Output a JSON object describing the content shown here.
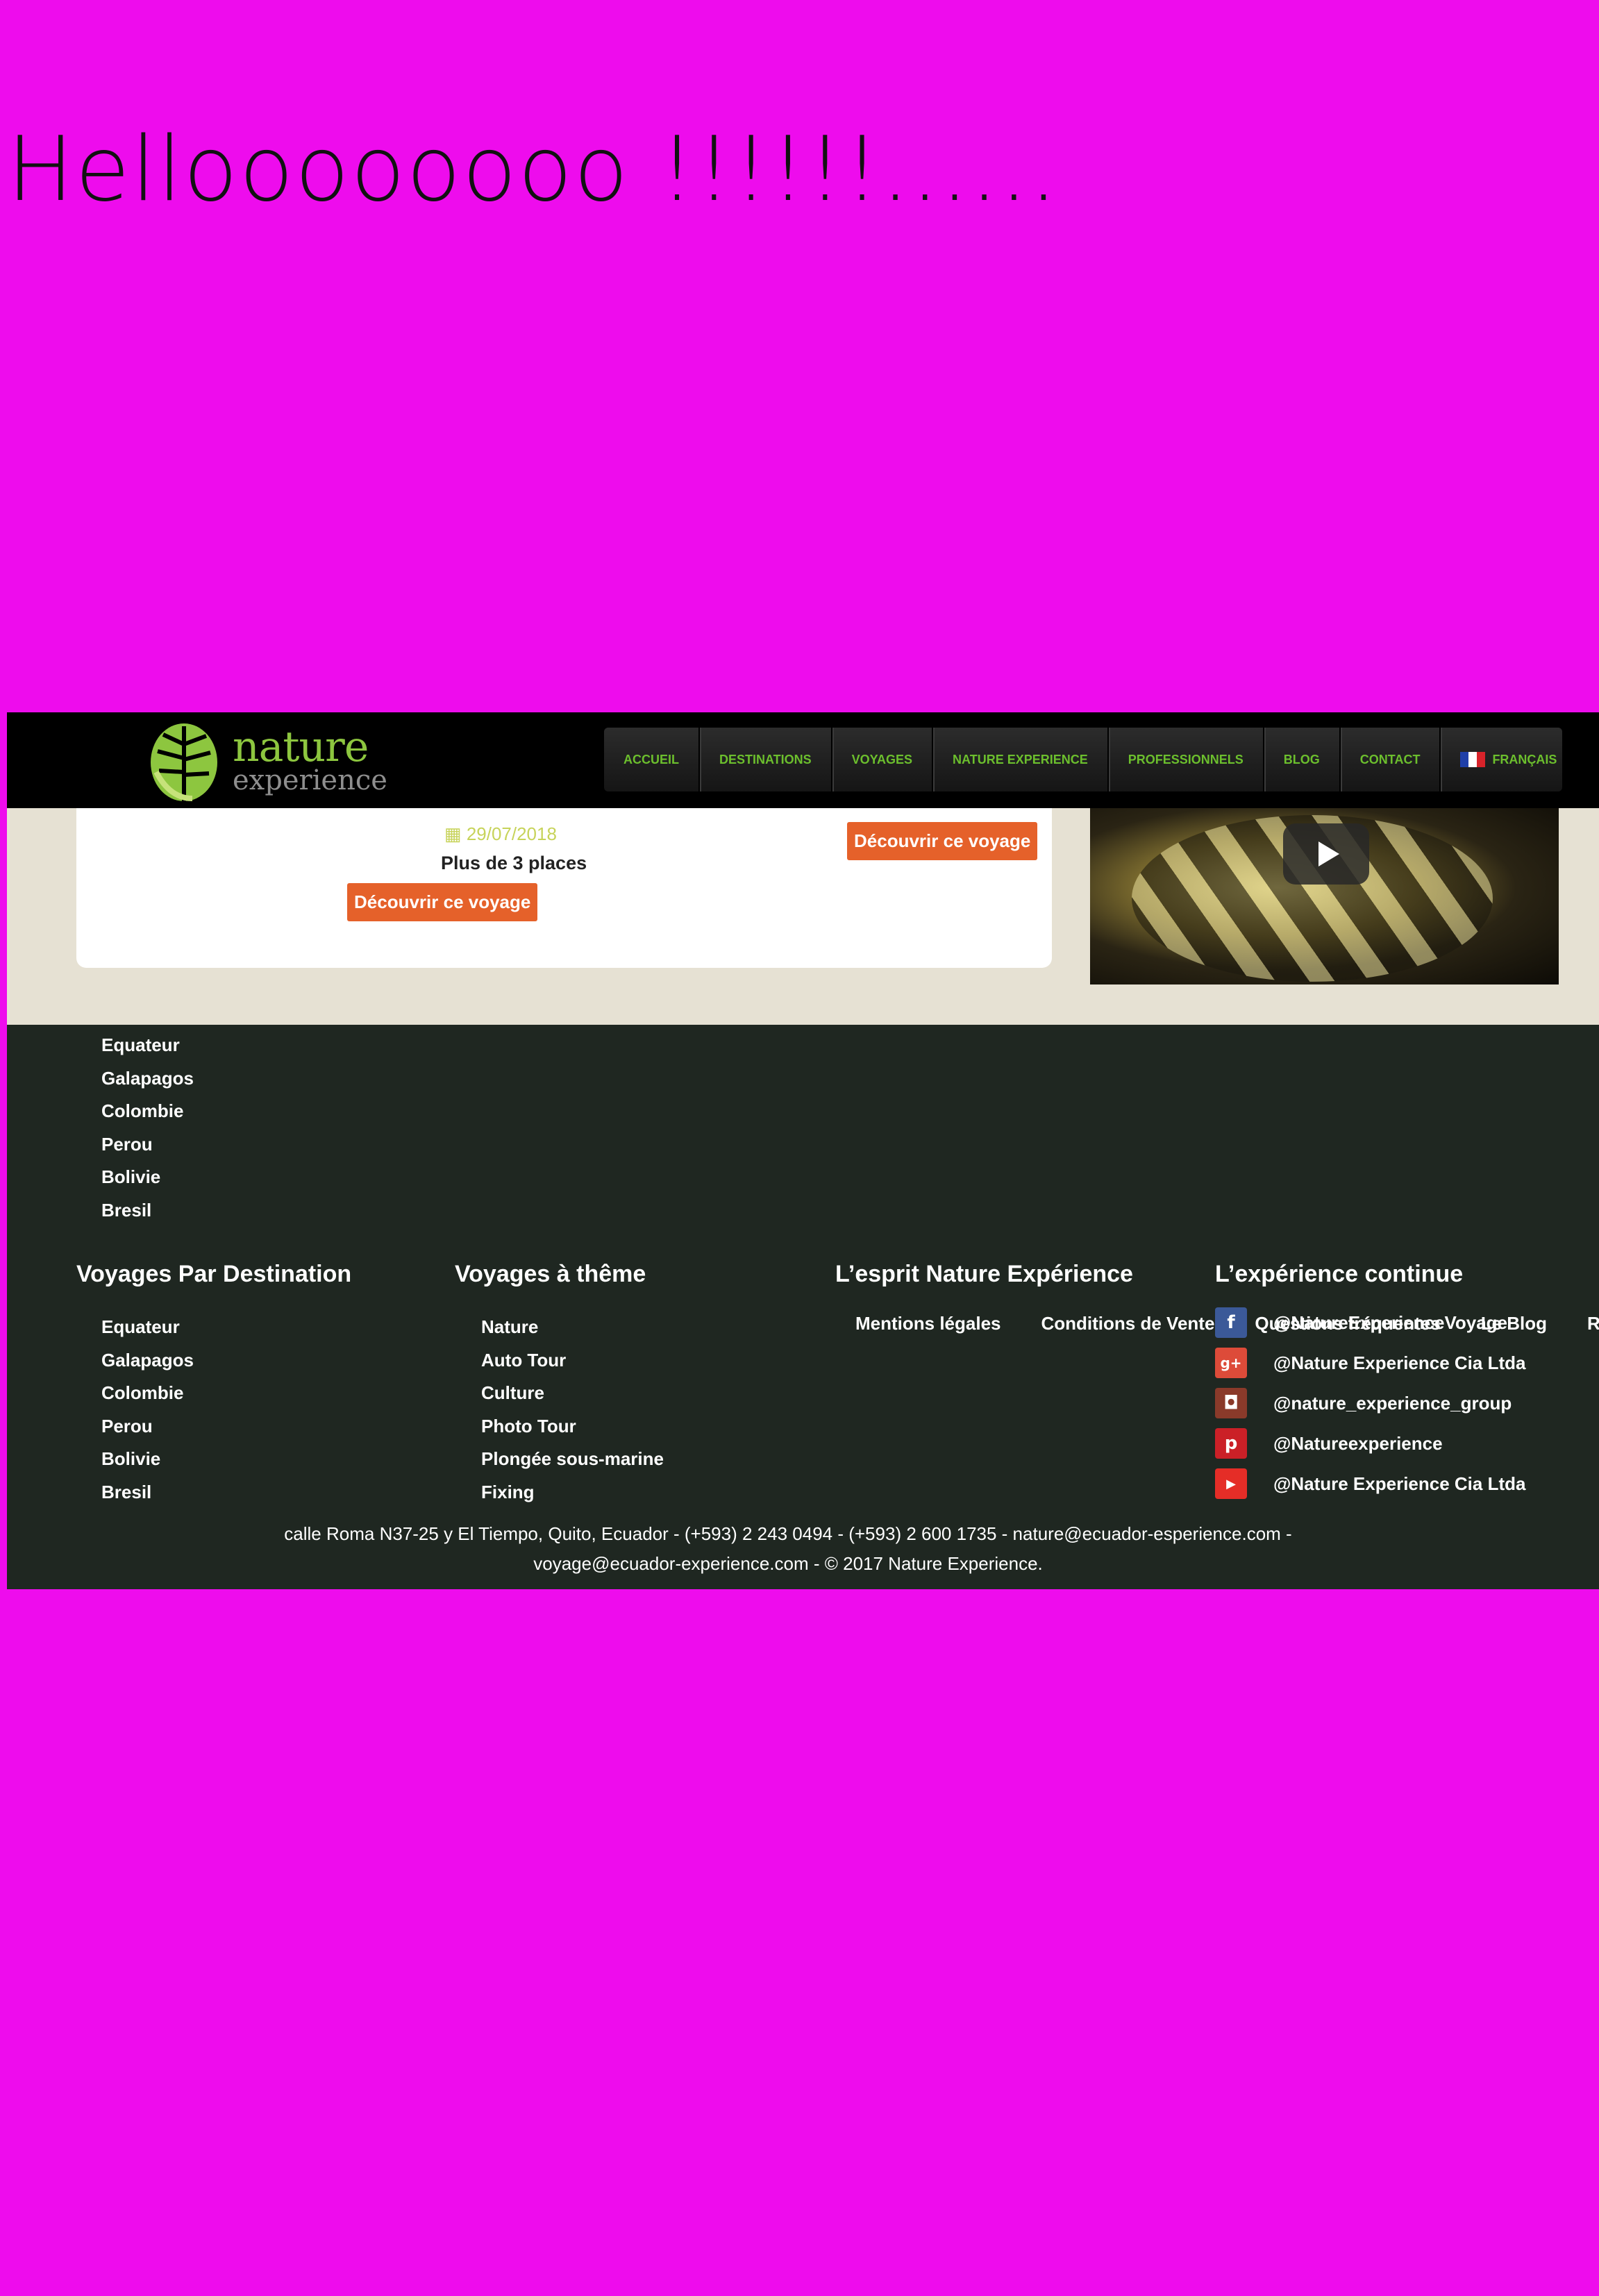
{
  "overlay": {
    "title": "Helloooooooo !!!!!!......"
  },
  "header": {
    "logo": {
      "word1": "nature",
      "word2": "experience"
    },
    "nav": [
      "ACCUEIL",
      "DESTINATIONS",
      "VOYAGES",
      "NATURE EXPERIENCE",
      "PROFESSIONNELS",
      "BLOG",
      "CONTACT"
    ],
    "language": "FRANÇAIS"
  },
  "trip": {
    "date": "29/07/2018",
    "places": "Plus de 3 places",
    "button1": "Découvrir ce voyage",
    "button2": "Découvrir ce voyage"
  },
  "footer": {
    "top_destinations": [
      "Equateur",
      "Galapagos",
      "Colombie",
      "Perou",
      "Bolivie",
      "Bresil"
    ],
    "col1": {
      "title": "Voyages Par Destination",
      "items": [
        "Equateur",
        "Galapagos",
        "Colombie",
        "Perou",
        "Bolivie",
        "Bresil"
      ]
    },
    "col2": {
      "title": "Voyages à thême",
      "items": [
        "Nature",
        "Auto Tour",
        "Culture",
        "Photo Tour",
        "Plongée sous-marine",
        "Fixing"
      ]
    },
    "col3": {
      "title": "L’esprit Nature Expérience",
      "links": [
        "Mentions légales",
        "Conditions de Vente",
        "Questions fréquentes",
        "Le Blog",
        "Re"
      ]
    },
    "col4": {
      "title": "L’expérience continue",
      "social": [
        {
          "icon": "facebook-icon",
          "glyph": "f",
          "color": "#3b5998",
          "label": "@NatureExperienceVoyage"
        },
        {
          "icon": "google-plus-icon",
          "glyph": "g+",
          "color": "#dd4b39",
          "label": "@Nature Experience Cia Ltda"
        },
        {
          "icon": "instagram-icon",
          "glyph": "◘",
          "color": "#8a3a2a",
          "label": "@nature_experience_group"
        },
        {
          "icon": "pinterest-icon",
          "glyph": "p",
          "color": "#cb2027",
          "label": "@Natureexperience"
        },
        {
          "icon": "youtube-icon",
          "glyph": "▶",
          "color": "#e52d27",
          "label": "@Nature Experience Cia Ltda"
        }
      ]
    },
    "address_line1": "calle Roma N37-25 y El Tiempo, Quito, Ecuador - (+593) 2 243 0494 - (+593) 2 600 1735 - nature@ecuador-esperience.com -",
    "address_line2": "voyage@ecuador-experience.com - © 2017 Nature Experience."
  },
  "colors": {
    "background": "#ee0ced",
    "accent_green": "#6cbf2d",
    "button_orange": "#e5612a",
    "footer_bg": "#1f2721"
  }
}
